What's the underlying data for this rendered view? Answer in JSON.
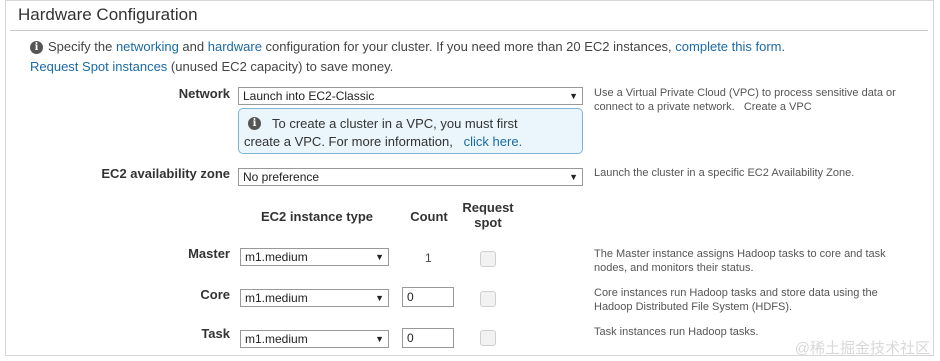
{
  "section": {
    "title": "Hardware Configuration"
  },
  "intro": {
    "p1": "Specify the ",
    "networking_link": "networking",
    "p2": " and ",
    "hardware_link": "hardware",
    "p3": " configuration for your cluster. If you need more than 20 EC2 instances, ",
    "complete_link": "complete this form.",
    "spot_link": "Request Spot instances",
    "p4": " (unused EC2 capacity) to save money."
  },
  "network": {
    "label": "Network",
    "selected": "Launch into EC2-Classic",
    "help": "Use a Virtual Private Cloud (VPC) to process sensitive data or connect to a private network.",
    "create_vpc_link": "Create a VPC",
    "notice_line1": "To create a cluster in a VPC, you must first",
    "notice_line2": "create a VPC. For more information,",
    "notice_link": "click here."
  },
  "az": {
    "label": "EC2 availability zone",
    "selected": "No preference",
    "help": "Launch the cluster in a specific EC2 Availability Zone."
  },
  "columns": {
    "instance_type": "EC2 instance type",
    "count": "Count",
    "request_spot_1": "Request",
    "request_spot_2": "spot"
  },
  "rows": [
    {
      "label": "Master",
      "type": "m1.medium",
      "count": "1",
      "help": "The Master instance assigns Hadoop tasks to core and task nodes, and monitors their status."
    },
    {
      "label": "Core",
      "type": "m1.medium",
      "count": "0",
      "help": "Core instances run Hadoop tasks and store data using the Hadoop Distributed File System (HDFS)."
    },
    {
      "label": "Task",
      "type": "m1.medium",
      "count": "0",
      "help": "Task instances run Hadoop tasks."
    }
  ],
  "watermark": "@稀土掘金技术社区"
}
